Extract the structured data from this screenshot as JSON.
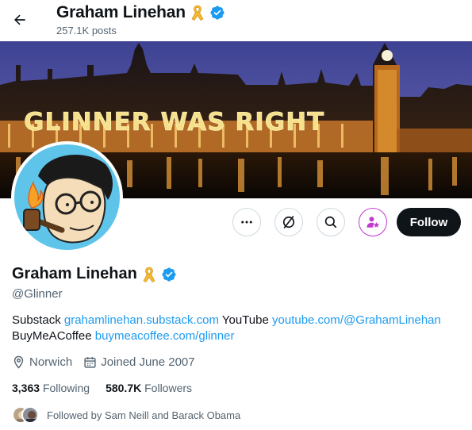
{
  "header": {
    "back_icon": "arrow-left-icon",
    "title": "Graham Linehan",
    "posts_count": "257.1K posts"
  },
  "banner": {
    "text": "GLINNER WAS RIGHT",
    "colors": {
      "sky": "#4a4f9a",
      "lights": "#f2a43a",
      "water": "#140c08"
    }
  },
  "actions": {
    "more_icon": "more-icon",
    "grok_icon": "grok-icon",
    "search_icon": "search-icon",
    "subscribe_icon": "subscribe-icon",
    "follow_label": "Follow"
  },
  "profile": {
    "name": "Graham Linehan",
    "handle": "@Glinner",
    "ribbon_icon": "yellow-ribbon-icon",
    "verified_icon": "verified-badge-icon",
    "bio": {
      "label_substack": "Substack",
      "link_substack": "grahamlinehan.substack.com",
      "label_youtube": "YouTube",
      "link_youtube": "youtube.com/@GrahamLinehan",
      "label_bmac": "BuyMeACoffee",
      "link_bmac": "buymeacoffee.com/glinner"
    },
    "location": "Norwich",
    "joined": "Joined June 2007",
    "following_count": "3,363",
    "following_label": "Following",
    "followers_count": "580.7K",
    "followers_label": "Followers",
    "followed_by": "Followed by Sam Neill and Barack Obama"
  },
  "colors": {
    "text": "#0f1419",
    "muted": "#536471",
    "link": "#1d9bf0",
    "verified": "#1d9bf0",
    "ribbon": "#f5b82e",
    "subscribe": "#c13ad1"
  }
}
